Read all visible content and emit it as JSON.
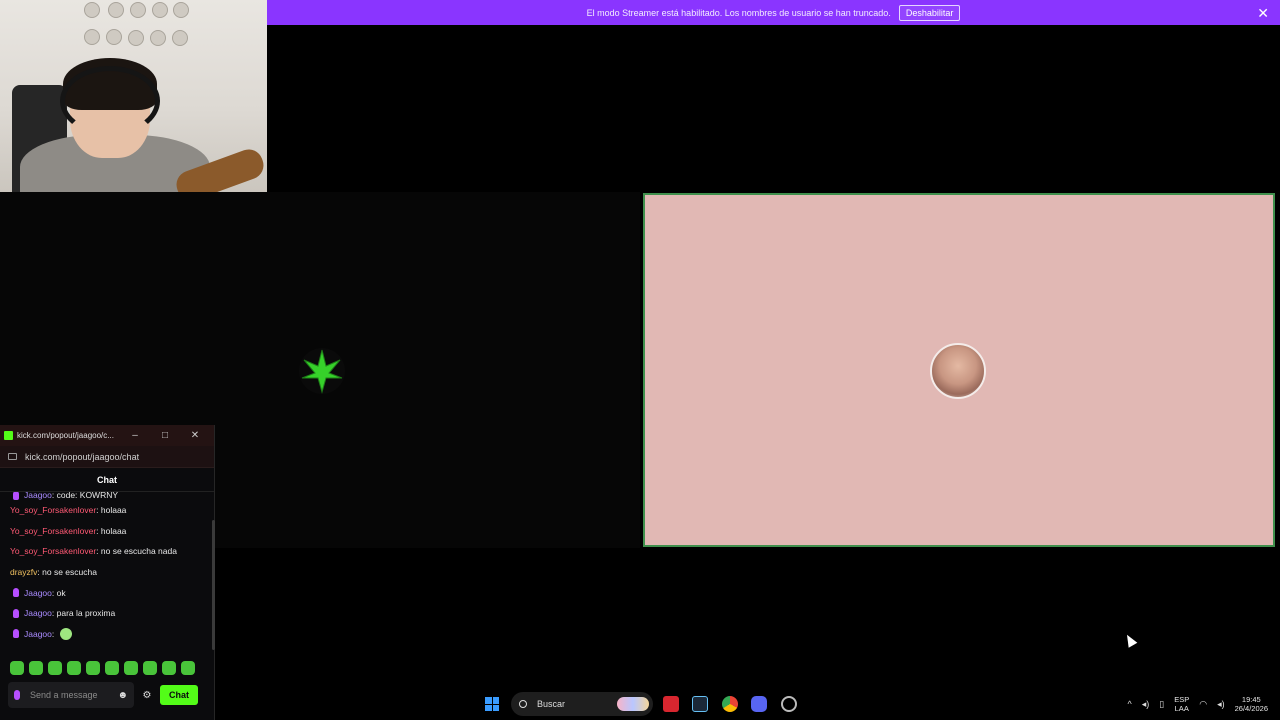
{
  "banner": {
    "message": "El modo Streamer está habilitado. Los nombres de usuario se han truncado.",
    "button_label": "Deshabilitar",
    "close_glyph": "✕"
  },
  "popout": {
    "window_title": "kick.com/popout/jaagoo/c...",
    "url": "kick.com/popout/jaagoo/chat",
    "chat_header": "Chat",
    "minimize_glyph": "–",
    "maximize_glyph": "□",
    "close_glyph": "✕",
    "messages": [
      {
        "user": "Jaagoo",
        "text": ": code: KOWRNY",
        "color": "#a98bff",
        "badge": true
      },
      {
        "user": "Yo_soy_Forsakenlover",
        "text": ": holaaa",
        "color": "#ff5a74",
        "badge": false
      },
      {
        "user": "Yo_soy_Forsakenlover",
        "text": ": holaaa",
        "color": "#ff5a74",
        "badge": false
      },
      {
        "user": "Yo_soy_Forsakenlover",
        "text": ": no se escucha nada",
        "color": "#ff5a74",
        "badge": false
      },
      {
        "user": "drayzfv",
        "text": ": no se escucha",
        "color": "#f0c060",
        "badge": false
      },
      {
        "user": "Jaagoo",
        "text": ": ok",
        "color": "#a98bff",
        "badge": true
      },
      {
        "user": "Jaagoo",
        "text": ": para la proxima",
        "color": "#a98bff",
        "badge": true
      },
      {
        "user": "Jaagoo",
        "text": ":",
        "color": "#a98bff",
        "badge": true,
        "emote": true
      }
    ],
    "input_placeholder": "Send a message",
    "send_label": "Chat",
    "settings_glyph": "⚙",
    "emoji_glyph": "☻"
  },
  "taskbar": {
    "search_label": "Buscar",
    "lang_top": "ESP",
    "lang_bottom": "LAA",
    "time": "19:45",
    "date": "26/4/2026",
    "tray_up_glyph": "^"
  },
  "colors": {
    "kick_green": "#53fc18",
    "banner_purple": "#8a35ff",
    "tile_pink": "#e1b8b4",
    "tile_border": "#3f8f4c"
  }
}
